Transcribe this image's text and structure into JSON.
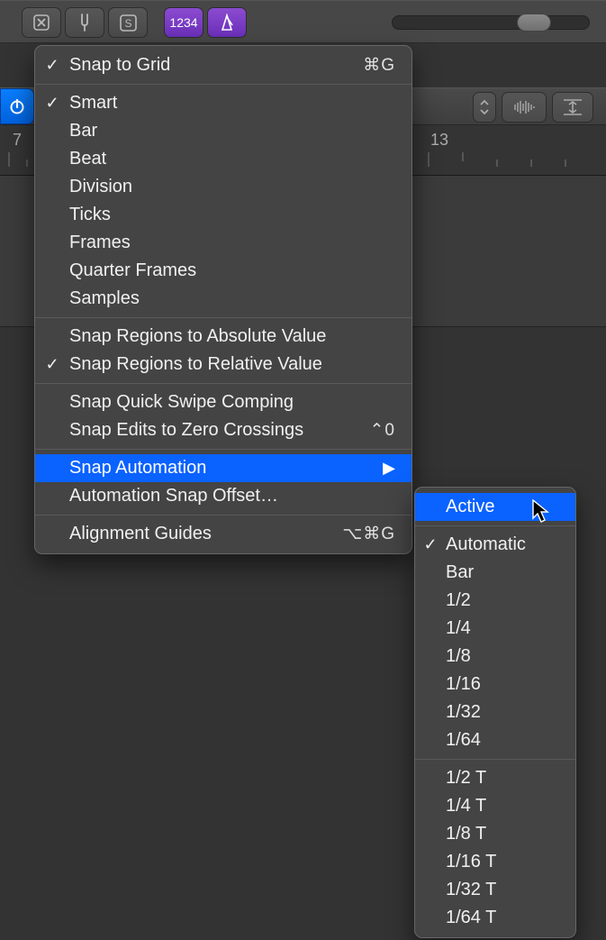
{
  "topbar": {
    "tool_1234": "1234"
  },
  "ruler": {
    "marks": [
      "7",
      "13"
    ]
  },
  "menu": {
    "snap_to_grid": {
      "label": "Snap to Grid",
      "shortcut": "⌘G",
      "checked": true
    },
    "group_resolution": [
      {
        "label": "Smart",
        "checked": true
      },
      {
        "label": "Bar",
        "checked": false
      },
      {
        "label": "Beat",
        "checked": false
      },
      {
        "label": "Division",
        "checked": false
      },
      {
        "label": "Ticks",
        "checked": false
      },
      {
        "label": "Frames",
        "checked": false
      },
      {
        "label": "Quarter Frames",
        "checked": false
      },
      {
        "label": "Samples",
        "checked": false
      }
    ],
    "group_region": [
      {
        "label": "Snap Regions to Absolute Value",
        "checked": false
      },
      {
        "label": "Snap Regions to Relative Value",
        "checked": true
      }
    ],
    "group_edit": [
      {
        "label": "Snap Quick Swipe Comping",
        "checked": false,
        "shortcut": ""
      },
      {
        "label": "Snap Edits to Zero Crossings",
        "checked": false,
        "shortcut": "⌃0"
      }
    ],
    "group_automation": [
      {
        "label": "Snap Automation",
        "sub": true,
        "highlighted": true
      },
      {
        "label": "Automation Snap Offset…"
      }
    ],
    "alignment_guides": {
      "label": "Alignment Guides",
      "shortcut": "⌥⌘G"
    }
  },
  "submenu": {
    "active": {
      "label": "Active",
      "highlighted": true
    },
    "group1": [
      {
        "label": "Automatic",
        "checked": true
      },
      {
        "label": "Bar",
        "checked": false
      },
      {
        "label": "1/2",
        "checked": false
      },
      {
        "label": "1/4",
        "checked": false
      },
      {
        "label": "1/8",
        "checked": false
      },
      {
        "label": "1/16",
        "checked": false
      },
      {
        "label": "1/32",
        "checked": false
      },
      {
        "label": "1/64",
        "checked": false
      }
    ],
    "group2": [
      {
        "label": "1/2 T",
        "checked": false
      },
      {
        "label": "1/4 T",
        "checked": false
      },
      {
        "label": "1/8 T",
        "checked": false
      },
      {
        "label": "1/16 T",
        "checked": false
      },
      {
        "label": "1/32 T",
        "checked": false
      },
      {
        "label": "1/64 T",
        "checked": false
      }
    ]
  }
}
